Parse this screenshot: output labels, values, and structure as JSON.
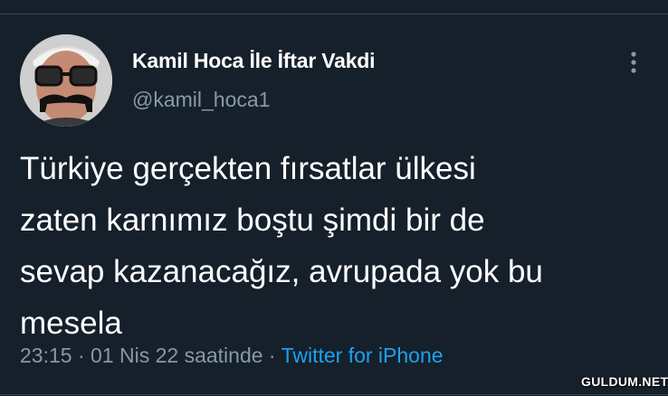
{
  "tweet": {
    "author": {
      "display_name": "Kamil Hoca İle İftar Vakdi",
      "handle": "@kamil_hoca1",
      "avatar_icon": "profile-photo-man-with-glasses-mustache-cap"
    },
    "more_icon": "more-vertical-icon",
    "text_lines": [
      "Türkiye gerçekten fırsatlar ülkesi",
      "zaten karnımız boştu şimdi bir de",
      "sevap kazanacağız, avrupada yok bu",
      "mesela"
    ],
    "time": "23:15",
    "separator": "·",
    "date": "01 Nis 22 saatinde",
    "source": "Twitter for iPhone"
  },
  "watermark": "GULDUM.NET",
  "colors": {
    "background": "#15202b",
    "primary_text": "#ffffff",
    "secondary_text": "#8899a6",
    "link": "#1da1f2",
    "divider": "#38444d"
  }
}
